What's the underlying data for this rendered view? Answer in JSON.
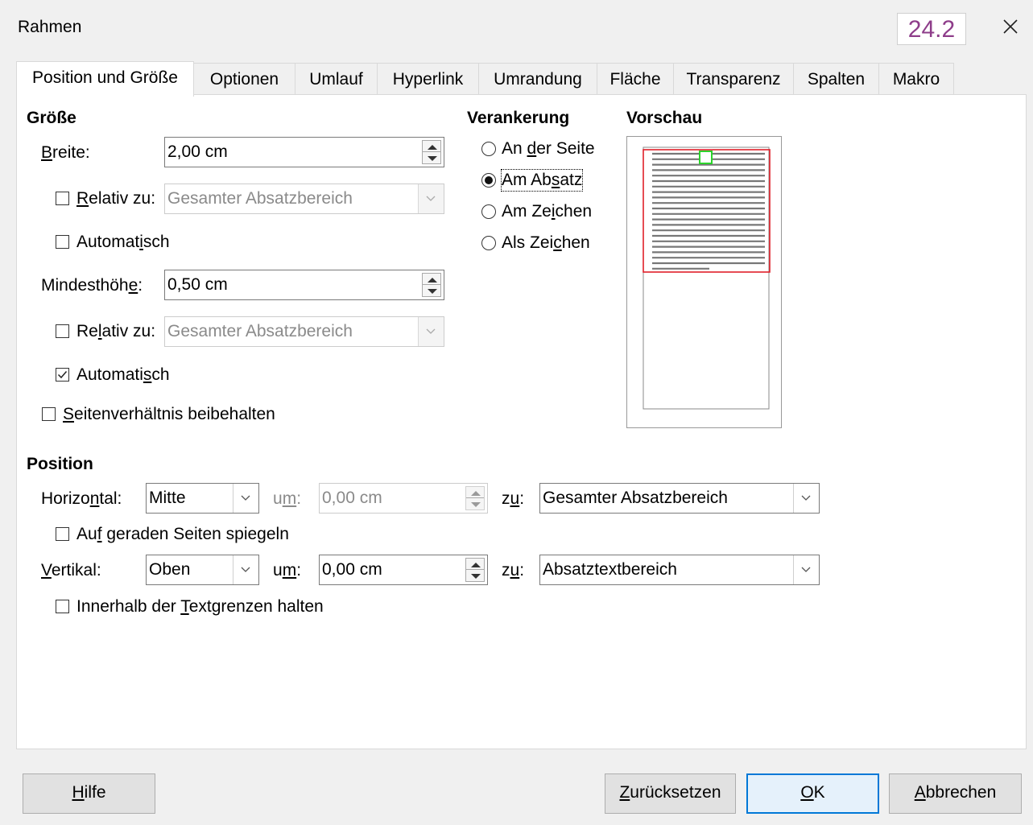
{
  "window": {
    "title": "Rahmen",
    "version_badge": "24.2",
    "close_icon": "close-icon"
  },
  "tabs": [
    {
      "label": "Position und Größe",
      "active": true
    },
    {
      "label": "Optionen"
    },
    {
      "label": "Umlauf"
    },
    {
      "label": "Hyperlink"
    },
    {
      "label": "Umrandung"
    },
    {
      "label": "Fläche"
    },
    {
      "label": "Transparenz"
    },
    {
      "label": "Spalten"
    },
    {
      "label": "Makro"
    }
  ],
  "groesse": {
    "heading": "Größe",
    "breite_label_pre": "",
    "breite_label_u": "B",
    "breite_label_post": "reite:",
    "breite_value": "2,00 cm",
    "relativ1_pre": "",
    "relativ1_u": "R",
    "relativ1_post": "elativ zu:",
    "relativ1_checked": false,
    "relativ1_combo": "Gesamter Absatzbereich",
    "auto1_pre": "Automat",
    "auto1_u": "i",
    "auto1_post": "sch",
    "auto1_checked": false,
    "hoehe_label_pre": "Mindesthöh",
    "hoehe_label_u": "e",
    "hoehe_label_post": ":",
    "hoehe_value": "0,50 cm",
    "relativ2_pre": "Re",
    "relativ2_u": "l",
    "relativ2_post": "ativ zu:",
    "relativ2_checked": false,
    "relativ2_combo": "Gesamter Absatzbereich",
    "auto2_pre": "Automati",
    "auto2_u": "s",
    "auto2_post": "ch",
    "auto2_checked": true,
    "ratio_pre": "",
    "ratio_u": "S",
    "ratio_post": "eitenverhältnis beibehalten",
    "ratio_checked": false
  },
  "verankerung": {
    "heading": "Verankerung",
    "options": [
      {
        "pre": "An ",
        "u": "d",
        "post": "er Seite",
        "selected": false
      },
      {
        "pre": "Am Ab",
        "u": "s",
        "post": "atz",
        "selected": true
      },
      {
        "pre": "Am Ze",
        "u": "i",
        "post": "chen",
        "selected": false
      },
      {
        "pre": "Als Zei",
        "u": "c",
        "post": "hen",
        "selected": false
      }
    ]
  },
  "vorschau": {
    "heading": "Vorschau"
  },
  "position": {
    "heading": "Position",
    "horizontal_pre": "Horizo",
    "horizontal_u": "n",
    "horizontal_post": "tal:",
    "horizontal_value": "Mitte",
    "um1_pre": "u",
    "um1_u": "m",
    "um1_post": ":",
    "um1_value": "0,00 cm",
    "zu1_pre": "z",
    "zu1_u": "u",
    "zu1_post": ":",
    "zu1_value": "Gesamter Absatzbereich",
    "spiegeln_pre": "Au",
    "spiegeln_u": "f",
    "spiegeln_post": " geraden Seiten spiegeln",
    "spiegeln_checked": false,
    "vertikal_pre": "",
    "vertikal_u": "V",
    "vertikal_post": "ertikal:",
    "vertikal_value": "Oben",
    "um2_pre": "u",
    "um2_u": "m",
    "um2_post": ":",
    "um2_value": "0,00 cm",
    "zu2_pre": "z",
    "zu2_u": "u",
    "zu2_post": ":",
    "zu2_value": "Absatztextbereich",
    "innerhalb_pre": "Innerhalb der ",
    "innerhalb_u": "T",
    "innerhalb_post": "extgrenzen halten",
    "innerhalb_checked": false
  },
  "buttons": {
    "hilfe_u": "H",
    "hilfe_post": "ilfe",
    "reset_u": "Z",
    "reset_post": "urücksetzen",
    "ok_u": "O",
    "ok_post": "K",
    "cancel_u": "A",
    "cancel_post": "bbrechen"
  },
  "colors": {
    "preview_frame": "#e0202a",
    "preview_anchor": "#2bd42b",
    "version_text": "#8e3d8a",
    "default_button_border": "#0078d7"
  }
}
